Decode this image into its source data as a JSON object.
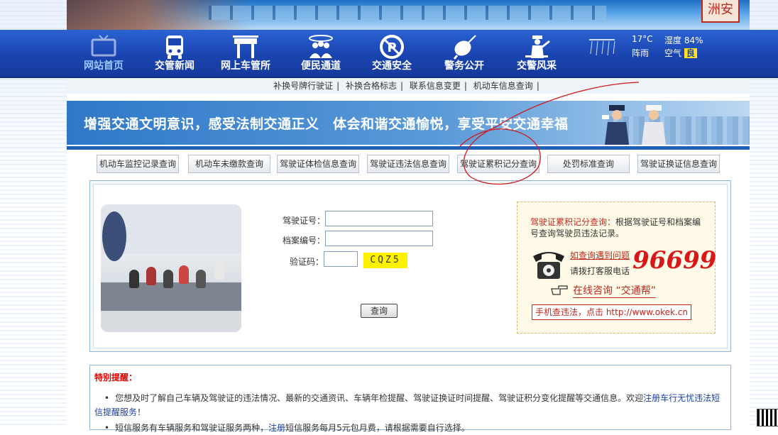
{
  "header": {
    "seal_text": "洲安"
  },
  "nav": {
    "items": [
      {
        "label": "网站首页",
        "icon": "tv-icon"
      },
      {
        "label": "交管新闻",
        "icon": "bus-icon"
      },
      {
        "label": "网上车管所",
        "icon": "gate-icon"
      },
      {
        "label": "便民通道",
        "icon": "people-icon"
      },
      {
        "label": "交通安全",
        "icon": "no-parking-icon"
      },
      {
        "label": "警务公开",
        "icon": "satellite-icon"
      },
      {
        "label": "交警风采",
        "icon": "officer-icon"
      }
    ]
  },
  "weather": {
    "temp": "17°C",
    "condition": "阵雨",
    "humidity_label": "湿度",
    "humidity": "84%",
    "air_label": "空气",
    "air_quality": "良"
  },
  "sublinks": [
    "补换号牌行驶证",
    "补换合格标志",
    "联系信息变更",
    "机动车信息查询"
  ],
  "slogan": "增强交通文明意识，感受法制交通正义　体会和谐交通愉悦，享受平安交通幸福",
  "query_tabs": [
    "机动车监控记录查询",
    "机动车未缴款查询",
    "驾驶证体检信息查询",
    "驾驶证违法信息查询",
    "驾驶证累积记分查询",
    "处罚标准查询",
    "驾驶证换证信息查询"
  ],
  "form": {
    "license_label": "驾驶证号：",
    "archive_label": "档案编号：",
    "captcha_label": "验证码：",
    "captcha_text": "CQZ5",
    "submit_label": "查询"
  },
  "info": {
    "desc_title": "驾驶证累积记分查询：",
    "desc_body": "根据驾驶证号和档案编号查询驾驶员违法记录。",
    "ask": "如查询遇到问题",
    "dial": "请拨打客服电话",
    "phone": "96699",
    "online": "在线咨询 “交通帮”",
    "mobile": "手机查违法，点击 http://www.okek.cn"
  },
  "reminder": {
    "title": "特别提醒：",
    "bullet": "•",
    "text": "您想及时了解自己车辆及驾驶证的违法情况、最新的交通资讯、车辆年检提醒、驾驶证换证时间提醒、驾驶证积分变化提醒等交通信息。欢迎",
    "link": "注册车行无忧违法短信提醒服务",
    "end": "！",
    "line2_pre": "短信服务有车辆服务和驾驶证服务两种，",
    "line2_link": "注册",
    "line2_post": "短信服务每月5元包月费，请根据需要自行选择。"
  },
  "colors": {
    "nav_bg": "#1a44b0",
    "accent_red": "#c0281d",
    "link_blue": "#1a3fa0",
    "captcha_yellow": "#fff200"
  }
}
